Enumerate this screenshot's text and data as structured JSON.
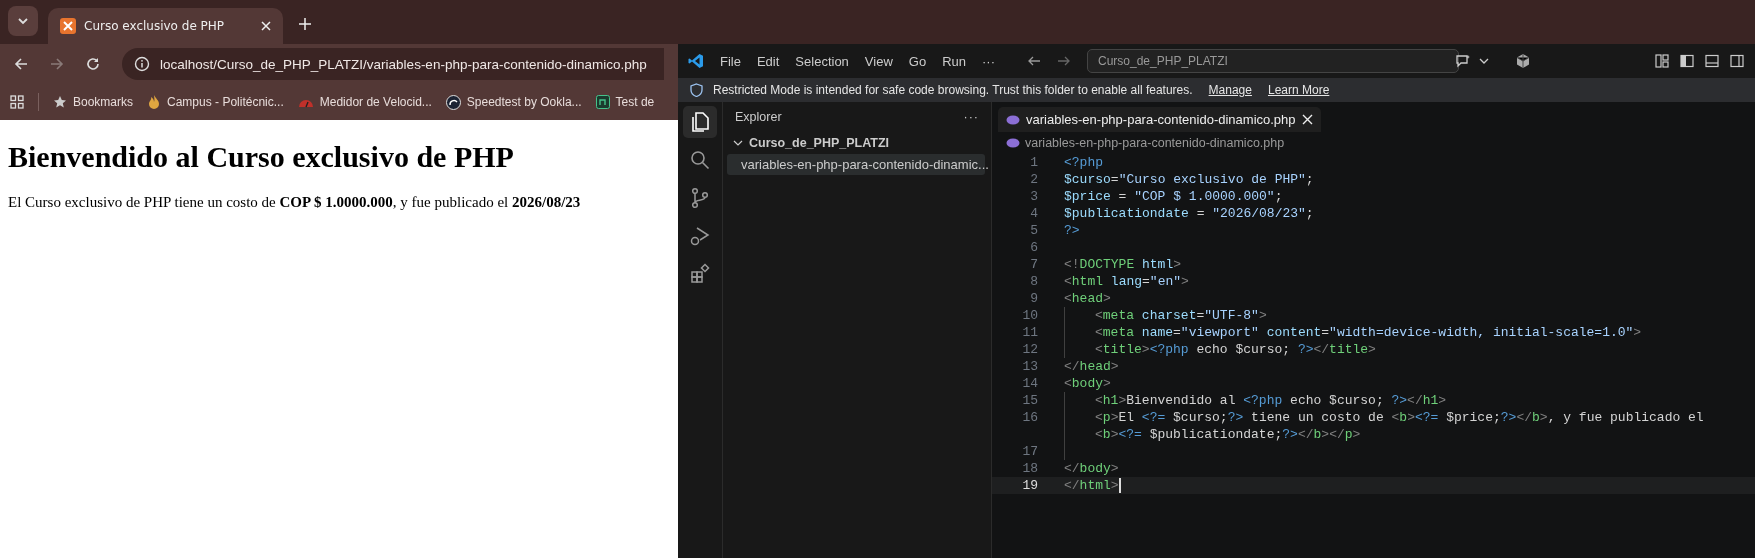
{
  "browser": {
    "tab": {
      "title": "Curso exclusivo de PHP",
      "selected": true
    },
    "address": "localhost/Curso_de_PHP_PLATZI/variables-en-php-para-contenido-dinamico.php",
    "bookmarks": [
      {
        "label": "Bookmarks",
        "kind": "star"
      },
      {
        "label": "Campus - Politécnic...",
        "kind": "flame"
      },
      {
        "label": "Medidor de Velocid...",
        "kind": "gauge"
      },
      {
        "label": "Speedtest by Ookla...",
        "kind": "speed"
      },
      {
        "label": "Test de",
        "kind": "square"
      }
    ],
    "page": {
      "heading": "Bienvendido al Curso exclusivo de PHP",
      "paragraph": "El Curso exclusivo de PHP tiene un costo de **COP $ 1.0000.000**, y fue publicado el **2026/08/23**"
    }
  },
  "vscode": {
    "menu": [
      "File",
      "Edit",
      "Selection",
      "View",
      "Go",
      "Run",
      "···"
    ],
    "command_center": "Curso_de_PHP_PLATZI",
    "banner": {
      "text": "Restricted Mode is intended for safe code browsing. Trust this folder to enable all features.",
      "links": [
        "Manage",
        "Learn More"
      ]
    },
    "activity": [
      {
        "kind": "files",
        "selected": true
      },
      {
        "kind": "search",
        "selected": false
      },
      {
        "kind": "branch",
        "selected": false
      },
      {
        "kind": "debug",
        "selected": false
      },
      {
        "kind": "extensions",
        "selected": false
      }
    ],
    "explorer": {
      "title": "Explorer",
      "more": "···",
      "folder": {
        "name": "Curso_de_PHP_PLATZI",
        "expanded": true
      },
      "files": [
        {
          "name": "variables-en-php-para-contenido-dinamic...",
          "selected": true
        }
      ]
    },
    "editor": {
      "tab": "variables-en-php-para-contenido-dinamico.php",
      "breadcrumb": "variables-en-php-para-contenido-dinamico.php",
      "lines": [
        {
          "number": "1",
          "indent": false,
          "current": false,
          "rows": [
            [
              {
                "text": "<?php",
                "kind": "php"
              }
            ]
          ]
        },
        {
          "number": "2",
          "indent": false,
          "current": false,
          "rows": [
            [
              {
                "text": "$curso",
                "kind": "var"
              },
              {
                "text": "=",
                "kind": "plain"
              },
              {
                "text": "\"Curso exclusivo de PHP\"",
                "kind": "str"
              },
              {
                "text": ";",
                "kind": "plain"
              }
            ]
          ]
        },
        {
          "number": "3",
          "indent": false,
          "current": false,
          "rows": [
            [
              {
                "text": "$price",
                "kind": "var"
              },
              {
                "text": " = ",
                "kind": "plain"
              },
              {
                "text": "\"COP $ 1.0000.000\"",
                "kind": "str"
              },
              {
                "text": ";",
                "kind": "plain"
              }
            ]
          ]
        },
        {
          "number": "4",
          "indent": false,
          "current": false,
          "rows": [
            [
              {
                "text": "$publicationdate",
                "kind": "var"
              },
              {
                "text": " = ",
                "kind": "plain"
              },
              {
                "text": "\"2026/08/23\"",
                "kind": "str"
              },
              {
                "text": ";",
                "kind": "plain"
              }
            ]
          ]
        },
        {
          "number": "5",
          "indent": false,
          "current": false,
          "rows": [
            [
              {
                "text": "?>",
                "kind": "php"
              }
            ]
          ]
        },
        {
          "number": "6",
          "indent": false,
          "current": false,
          "rows": [
            []
          ]
        },
        {
          "number": "7",
          "indent": false,
          "current": false,
          "rows": [
            [
              {
                "text": "<!",
                "kind": "punct"
              },
              {
                "text": "DOCTYPE",
                "kind": "tag"
              },
              {
                "text": " html",
                "kind": "attr"
              },
              {
                "text": ">",
                "kind": "punct"
              }
            ]
          ]
        },
        {
          "number": "8",
          "indent": false,
          "current": false,
          "rows": [
            [
              {
                "text": "<",
                "kind": "punct"
              },
              {
                "text": "html",
                "kind": "tag"
              },
              {
                "text": " lang",
                "kind": "attr"
              },
              {
                "text": "=",
                "kind": "plain"
              },
              {
                "text": "\"en\"",
                "kind": "str"
              },
              {
                "text": ">",
                "kind": "punct"
              }
            ]
          ]
        },
        {
          "number": "9",
          "indent": false,
          "current": false,
          "rows": [
            [
              {
                "text": "<",
                "kind": "punct"
              },
              {
                "text": "head",
                "kind": "tag"
              },
              {
                "text": ">",
                "kind": "punct"
              }
            ]
          ]
        },
        {
          "number": "10",
          "indent": true,
          "current": false,
          "rows": [
            [
              {
                "text": "<",
                "kind": "punct"
              },
              {
                "text": "meta",
                "kind": "tag"
              },
              {
                "text": " charset",
                "kind": "attr"
              },
              {
                "text": "=",
                "kind": "plain"
              },
              {
                "text": "\"UTF-8\"",
                "kind": "str"
              },
              {
                "text": ">",
                "kind": "punct"
              }
            ]
          ]
        },
        {
          "number": "11",
          "indent": true,
          "current": false,
          "rows": [
            [
              {
                "text": "<",
                "kind": "punct"
              },
              {
                "text": "meta",
                "kind": "tag"
              },
              {
                "text": " name",
                "kind": "attr"
              },
              {
                "text": "=",
                "kind": "plain"
              },
              {
                "text": "\"viewport\"",
                "kind": "str"
              },
              {
                "text": " content",
                "kind": "attr"
              },
              {
                "text": "=",
                "kind": "plain"
              },
              {
                "text": "\"width=device-width, initial-scale=1.0\"",
                "kind": "str"
              },
              {
                "text": ">",
                "kind": "punct"
              }
            ]
          ]
        },
        {
          "number": "12",
          "indent": true,
          "current": false,
          "rows": [
            [
              {
                "text": "<",
                "kind": "punct"
              },
              {
                "text": "title",
                "kind": "tag"
              },
              {
                "text": ">",
                "kind": "punct"
              },
              {
                "text": "<?php",
                "kind": "php"
              },
              {
                "text": " echo $curso; ",
                "kind": "plain"
              },
              {
                "text": "?>",
                "kind": "php"
              },
              {
                "text": "</",
                "kind": "punct"
              },
              {
                "text": "title",
                "kind": "tag"
              },
              {
                "text": ">",
                "kind": "punct"
              }
            ]
          ]
        },
        {
          "number": "13",
          "indent": false,
          "current": false,
          "rows": [
            [
              {
                "text": "</",
                "kind": "punct"
              },
              {
                "text": "head",
                "kind": "tag"
              },
              {
                "text": ">",
                "kind": "punct"
              }
            ]
          ]
        },
        {
          "number": "14",
          "indent": false,
          "current": false,
          "rows": [
            [
              {
                "text": "<",
                "kind": "punct"
              },
              {
                "text": "body",
                "kind": "tag"
              },
              {
                "text": ">",
                "kind": "punct"
              }
            ]
          ]
        },
        {
          "number": "15",
          "indent": true,
          "current": false,
          "rows": [
            [
              {
                "text": "<",
                "kind": "punct"
              },
              {
                "text": "h1",
                "kind": "tag"
              },
              {
                "text": ">",
                "kind": "punct"
              },
              {
                "text": "Bienvendido al ",
                "kind": "plain"
              },
              {
                "text": "<?php",
                "kind": "php"
              },
              {
                "text": " echo $curso; ",
                "kind": "plain"
              },
              {
                "text": "?>",
                "kind": "php"
              },
              {
                "text": "</",
                "kind": "punct"
              },
              {
                "text": "h1",
                "kind": "tag"
              },
              {
                "text": ">",
                "kind": "punct"
              }
            ]
          ]
        },
        {
          "number": "16",
          "indent": true,
          "current": false,
          "rows": [
            [
              {
                "text": "<",
                "kind": "punct"
              },
              {
                "text": "p",
                "kind": "tag"
              },
              {
                "text": ">",
                "kind": "punct"
              },
              {
                "text": "El ",
                "kind": "plain"
              },
              {
                "text": "<?=",
                "kind": "php"
              },
              {
                "text": " $curso;",
                "kind": "plain"
              },
              {
                "text": "?>",
                "kind": "php"
              },
              {
                "text": " tiene un costo de ",
                "kind": "plain"
              },
              {
                "text": "<",
                "kind": "punct"
              },
              {
                "text": "b",
                "kind": "tag"
              },
              {
                "text": ">",
                "kind": "punct"
              },
              {
                "text": "<?=",
                "kind": "php"
              },
              {
                "text": " $price;",
                "kind": "plain"
              },
              {
                "text": "?>",
                "kind": "php"
              },
              {
                "text": "</",
                "kind": "punct"
              },
              {
                "text": "b",
                "kind": "tag"
              },
              {
                "text": ">",
                "kind": "punct"
              },
              {
                "text": ", y fue publicado el",
                "kind": "plain"
              }
            ]
          ],
          "wrap": [
            {
              "text": "<",
              "kind": "punct"
            },
            {
              "text": "b",
              "kind": "tag"
            },
            {
              "text": ">",
              "kind": "punct"
            },
            {
              "text": "<?=",
              "kind": "php"
            },
            {
              "text": " $publicationdate;",
              "kind": "plain"
            },
            {
              "text": "?>",
              "kind": "php"
            },
            {
              "text": "</",
              "kind": "punct"
            },
            {
              "text": "b",
              "kind": "tag"
            },
            {
              "text": ">",
              "kind": "punct"
            },
            {
              "text": "</",
              "kind": "punct"
            },
            {
              "text": "p",
              "kind": "tag"
            },
            {
              "text": ">",
              "kind": "punct"
            }
          ]
        },
        {
          "number": "17",
          "indent": true,
          "current": false,
          "rows": [
            []
          ]
        },
        {
          "number": "18",
          "indent": false,
          "current": false,
          "rows": [
            [
              {
                "text": "</",
                "kind": "punct"
              },
              {
                "text": "body",
                "kind": "tag"
              },
              {
                "text": ">",
                "kind": "punct"
              }
            ]
          ]
        },
        {
          "number": "19",
          "indent": false,
          "current": true,
          "rows": [
            [
              {
                "text": "</",
                "kind": "punct"
              },
              {
                "text": "html",
                "kind": "tag"
              },
              {
                "text": ">",
                "kind": "punct"
              }
            ]
          ]
        }
      ]
    }
  }
}
